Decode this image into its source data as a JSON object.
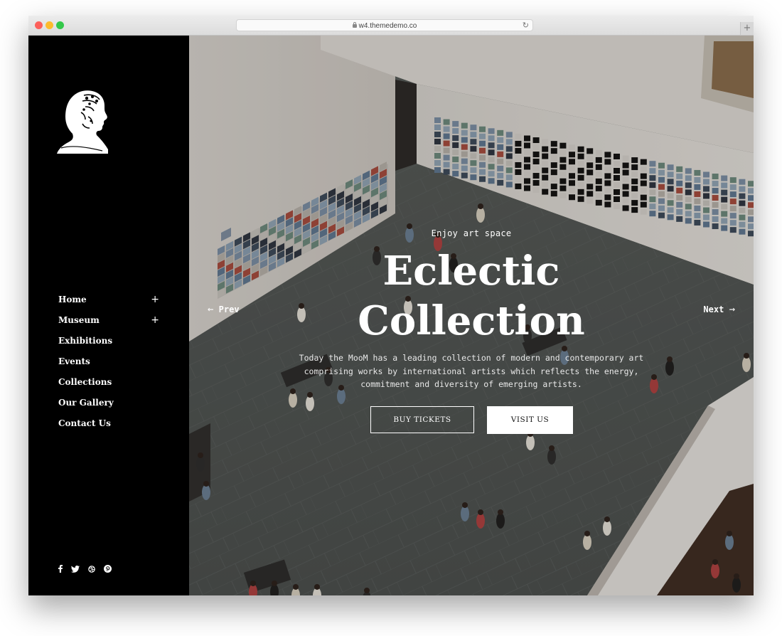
{
  "browser": {
    "url": "w4.themedemo.co",
    "new_tab": "+"
  },
  "sidebar": {
    "logo_icon": "bust-statue-logo",
    "nav": [
      {
        "label": "Home",
        "has_submenu": true
      },
      {
        "label": "Museum",
        "has_submenu": true
      },
      {
        "label": "Exhibitions",
        "has_submenu": false
      },
      {
        "label": "Events",
        "has_submenu": false
      },
      {
        "label": "Collections",
        "has_submenu": false
      },
      {
        "label": "Our Gallery",
        "has_submenu": false
      },
      {
        "label": "Contact Us",
        "has_submenu": false
      }
    ],
    "submenu_glyph": "+",
    "social": [
      "facebook-icon",
      "twitter-icon",
      "dribbble-icon",
      "pinterest-icon"
    ]
  },
  "hero": {
    "eyebrow": "Enjoy art space",
    "title_line1": "Eclectic",
    "title_line2": "Collection",
    "description": "Today the MooM has a leading collection of modern and contemporary art comprising works by international artists which reflects the energy, commitment and diversity of emerging artists.",
    "btn_primary": "BUY TICKETS",
    "btn_secondary": "VISIT US",
    "prev": "Prev",
    "next": "Next"
  },
  "colors": {
    "sidebar_bg": "#000000",
    "text": "#ffffff",
    "button_bg": "#ffffff"
  }
}
